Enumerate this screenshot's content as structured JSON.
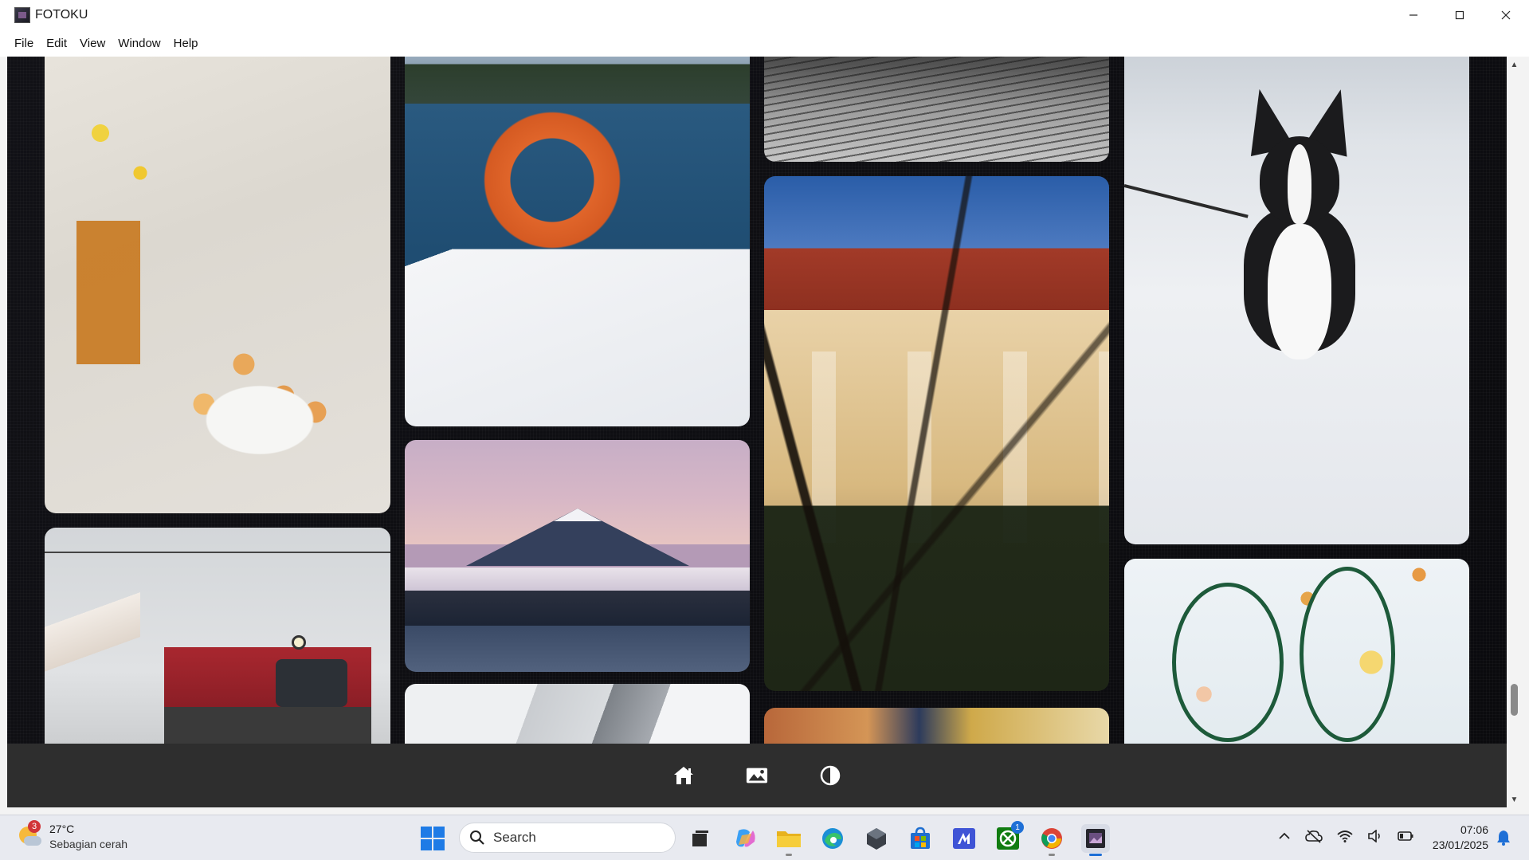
{
  "window": {
    "title": "FOTOKU",
    "controls": {
      "minimize": "—",
      "maximize": "☐",
      "close": "✕"
    }
  },
  "menu": {
    "items": [
      "File",
      "Edit",
      "View",
      "Window",
      "Help"
    ]
  },
  "gallery": {
    "photos": [
      {
        "subject": "food-table"
      },
      {
        "subject": "tram-station"
      },
      {
        "subject": "lifebuoy-pier"
      },
      {
        "subject": "mount-fuji"
      },
      {
        "subject": "glass-architecture"
      },
      {
        "subject": "dirt-road-bw"
      },
      {
        "subject": "yellow-building-tree"
      },
      {
        "subject": "autumn-street"
      },
      {
        "subject": "corgi-in-snow"
      },
      {
        "subject": "floral-mosaic"
      }
    ]
  },
  "bottom_nav": {
    "icons": [
      "home-icon",
      "image-icon",
      "contrast-icon"
    ]
  },
  "taskbar": {
    "weather": {
      "temp": "27°C",
      "desc": "Sebagian cerah",
      "badge": "3"
    },
    "search_label": "Search",
    "apps": [
      "task-view-icon",
      "copilot-icon",
      "file-explorer-icon",
      "edge-icon",
      "cube-app-icon",
      "store-icon",
      "visual-studio-icon",
      "xbox-icon",
      "chrome-icon",
      "fotoku-icon"
    ],
    "xbox_badge": "1",
    "clock": {
      "time": "07:06",
      "date": "23/01/2025"
    }
  },
  "colors": {
    "accent": "#1e6fd6",
    "nav_bar": "#2e2e2e",
    "content_bg": "#0c0c10"
  }
}
